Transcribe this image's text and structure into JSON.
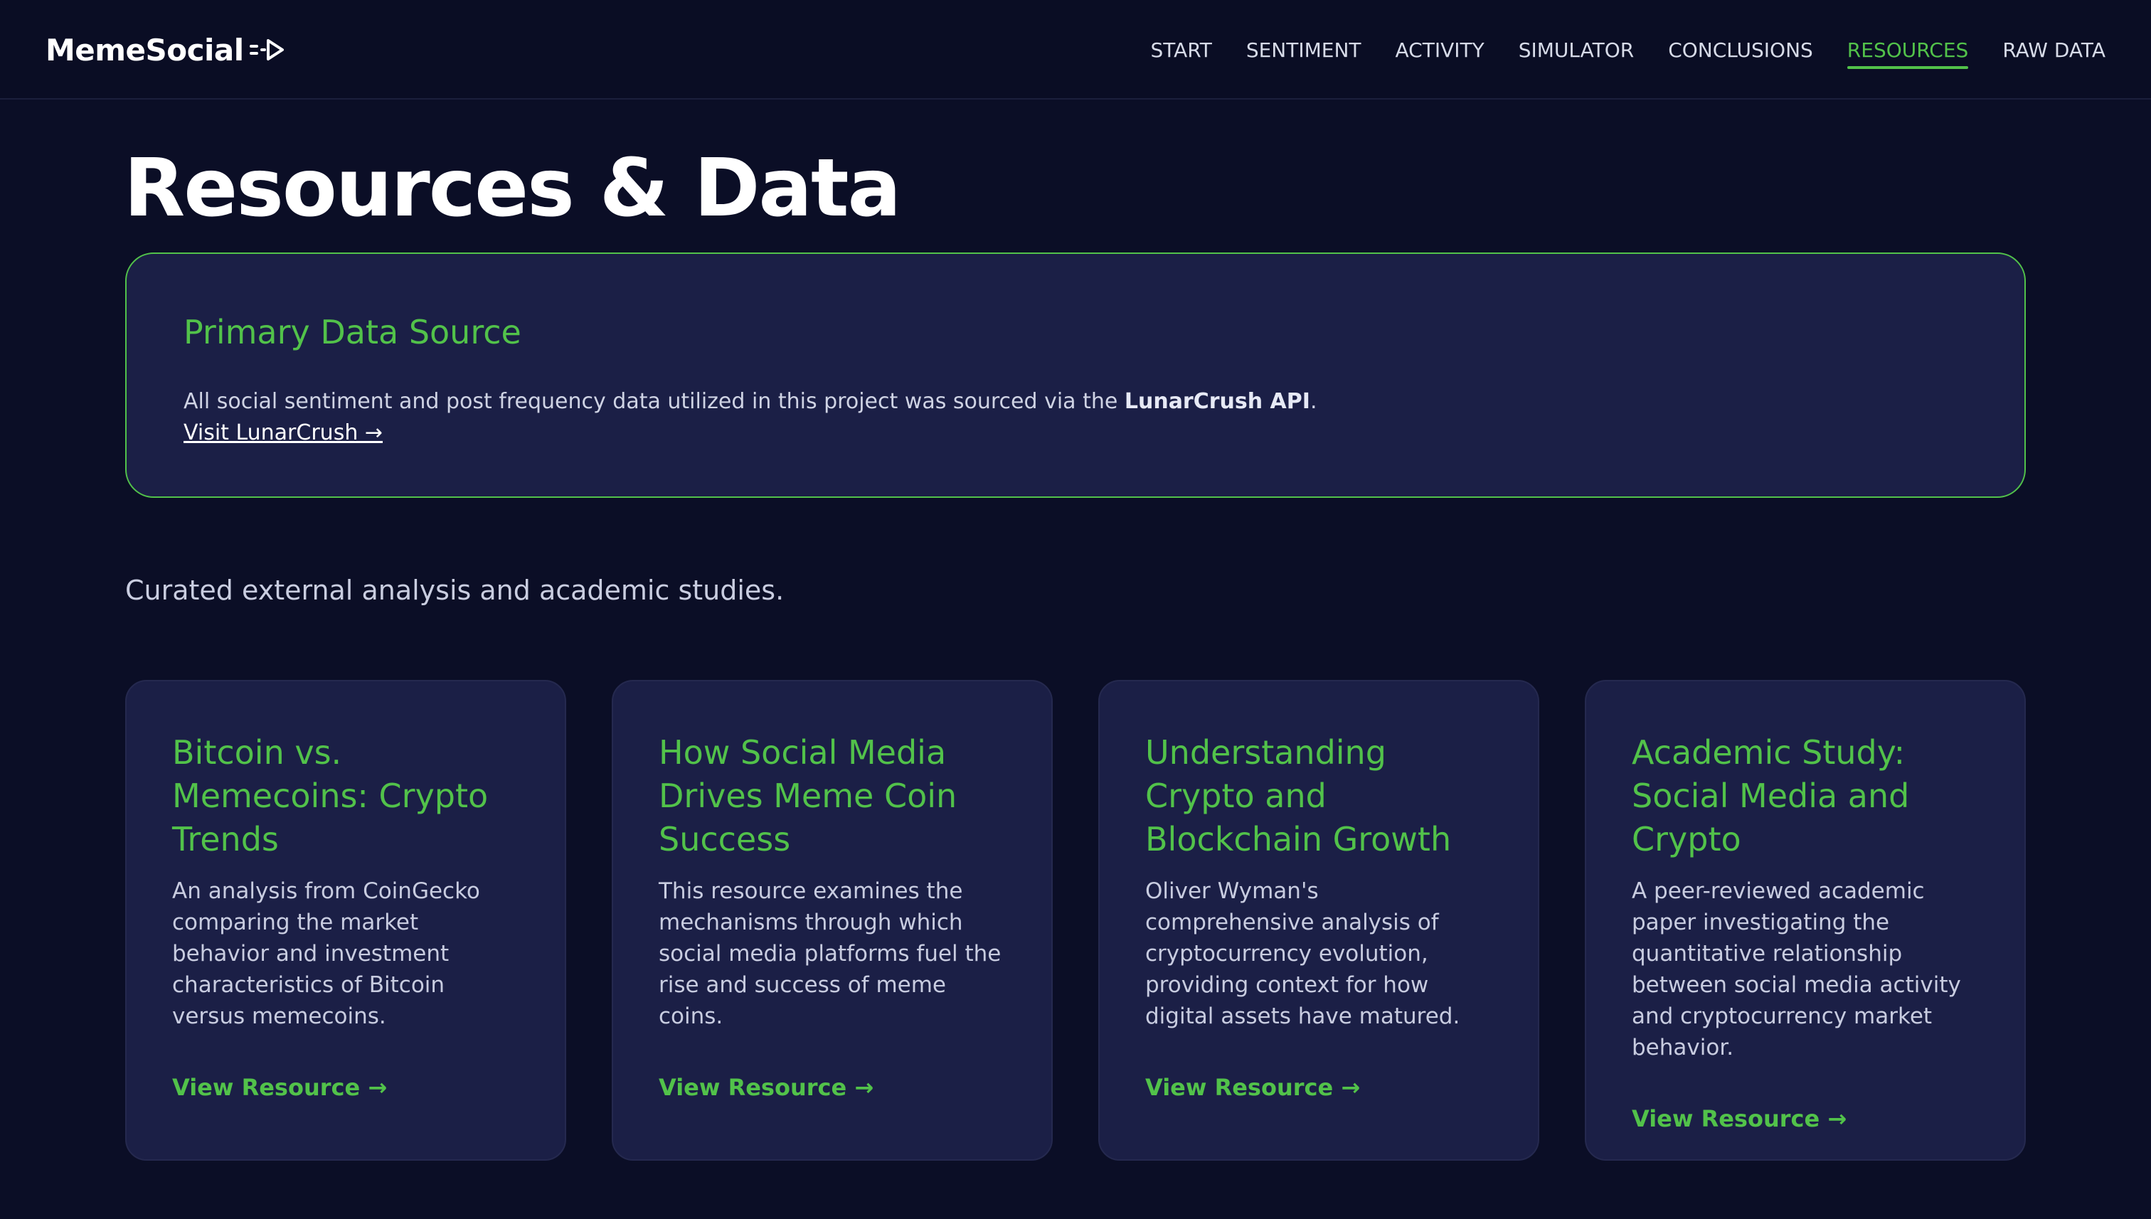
{
  "brand": {
    "name": "MemeSocial",
    "logo_icon": "arrow-play-icon",
    "accent_color": "#52c24a"
  },
  "nav": {
    "items": [
      {
        "label": "START"
      },
      {
        "label": "SENTIMENT"
      },
      {
        "label": "ACTIVITY"
      },
      {
        "label": "SIMULATOR"
      },
      {
        "label": "CONCLUSIONS"
      },
      {
        "label": "RESOURCES",
        "active": true
      },
      {
        "label": "RAW DATA"
      }
    ]
  },
  "page": {
    "title": "Resources & Data",
    "subtitle": "Curated external analysis and academic studies."
  },
  "primary_source": {
    "title": "Primary Data Source",
    "text_before": "All social sentiment and post frequency data utilized in this project was sourced via the ",
    "highlight": "LunarCrush API",
    "text_after": ".",
    "link_label": "Visit LunarCrush →"
  },
  "cards": [
    {
      "title": "Bitcoin vs. Memecoins: Crypto Trends",
      "description": "An analysis from CoinGecko comparing the market behavior and investment characteristics of Bitcoin versus memecoins.",
      "link_label": "View Resource →"
    },
    {
      "title": "How Social Media Drives Meme Coin Success",
      "description": "This resource examines the mechanisms through which social media platforms fuel the rise and success of meme coins.",
      "link_label": "View Resource →"
    },
    {
      "title": "Understanding Crypto and Blockchain Growth",
      "description": "Oliver Wyman's comprehensive analysis of cryptocurrency evolution, providing context for how digital assets have matured.",
      "link_label": "View Resource →"
    },
    {
      "title": "Academic Study: Social Media and Crypto",
      "description": "A peer-reviewed academic paper investigating the quantitative relationship between social media activity and cryptocurrency market behavior.",
      "link_label": "View Resource →"
    }
  ]
}
